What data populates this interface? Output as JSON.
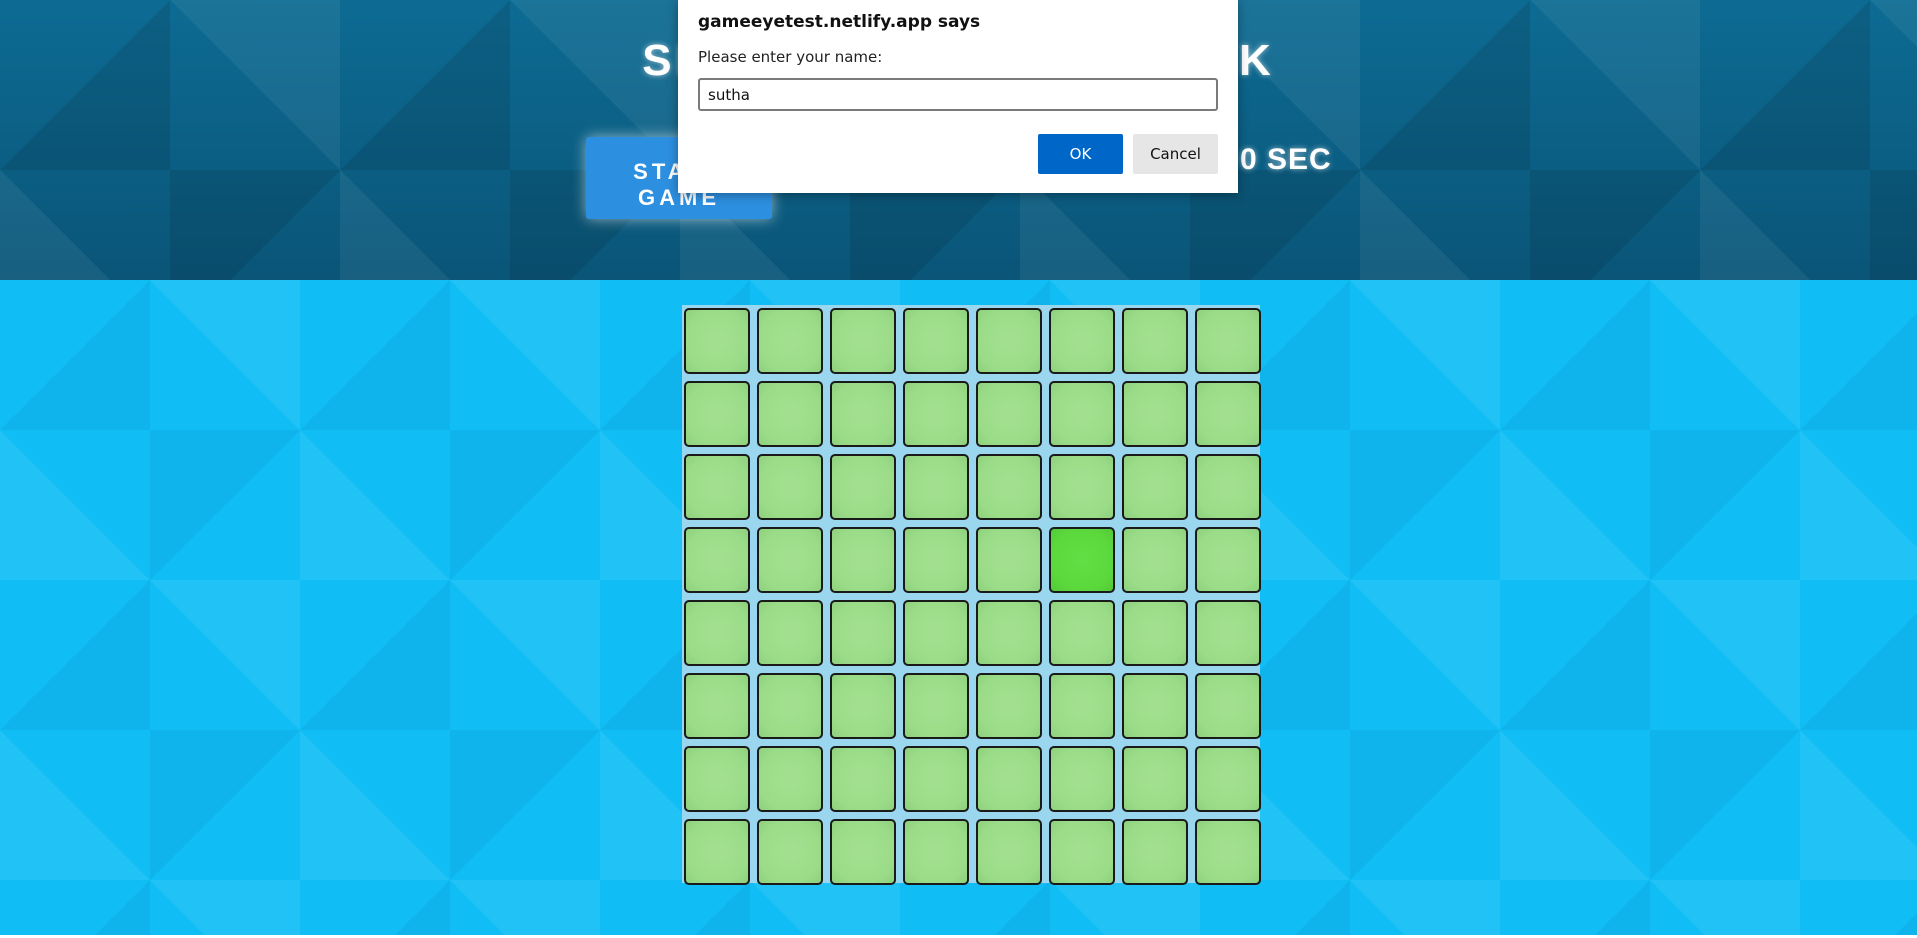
{
  "header": {
    "title": "SELECT THE ODD BLOCK",
    "start_button": "START GAME",
    "timer": "0 SEC"
  },
  "board": {
    "rows": 8,
    "cols": 8,
    "odd_cell": {
      "row": 4,
      "col": 6
    },
    "colors": {
      "normal": "#9bdc88",
      "odd": "#5bd83c",
      "border": "#1a1a1a"
    }
  },
  "dialog": {
    "title": "gameeyetest.netlify.app says",
    "message": "Please enter your name:",
    "input_value": "sutha",
    "ok_label": "OK",
    "cancel_label": "Cancel"
  },
  "colors": {
    "header_bg": "#0a5a7e",
    "play_bg": "#10bdf5",
    "start_button": "#2d8fe0",
    "ok_button": "#0067c9"
  }
}
